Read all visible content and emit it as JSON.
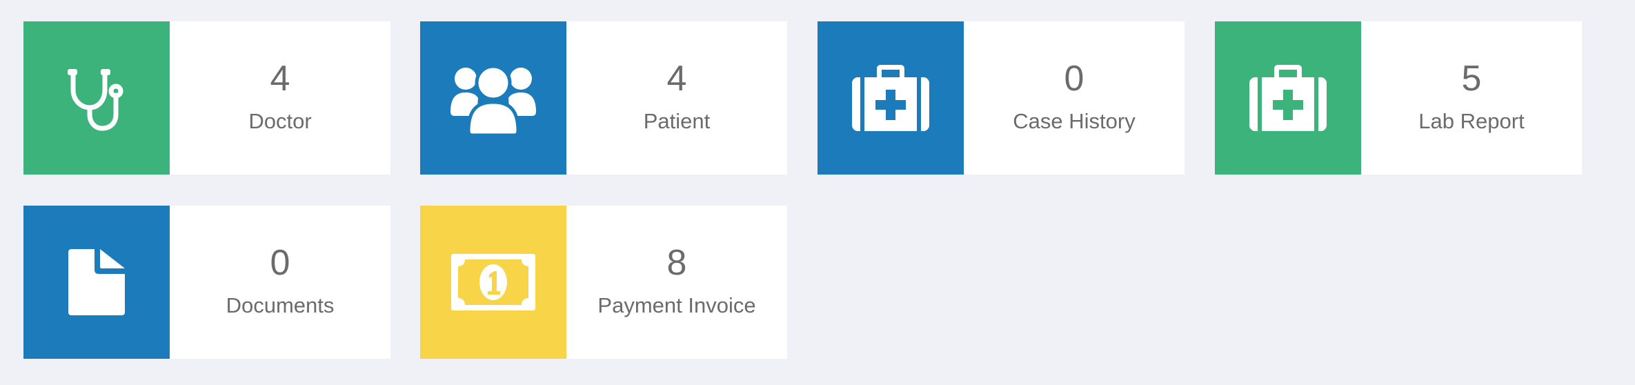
{
  "colors": {
    "background": "#f0f1f6",
    "green": "#3bb37b",
    "blue": "#1b7bbb",
    "yellow": "#f8d448",
    "text": "#6b6b6b"
  },
  "cards": [
    {
      "count": "4",
      "label": "Doctor",
      "icon": "stethoscope-icon",
      "color": "green"
    },
    {
      "count": "4",
      "label": "Patient",
      "icon": "users-icon",
      "color": "blue"
    },
    {
      "count": "0",
      "label": "Case History",
      "icon": "medical-kit-icon",
      "color": "blue"
    },
    {
      "count": "5",
      "label": "Lab Report",
      "icon": "medical-kit-icon",
      "color": "green"
    },
    {
      "count": "0",
      "label": "Documents",
      "icon": "document-icon",
      "color": "blue"
    },
    {
      "count": "8",
      "label": "Payment Invoice",
      "icon": "money-bill-icon",
      "color": "yellow"
    }
  ]
}
